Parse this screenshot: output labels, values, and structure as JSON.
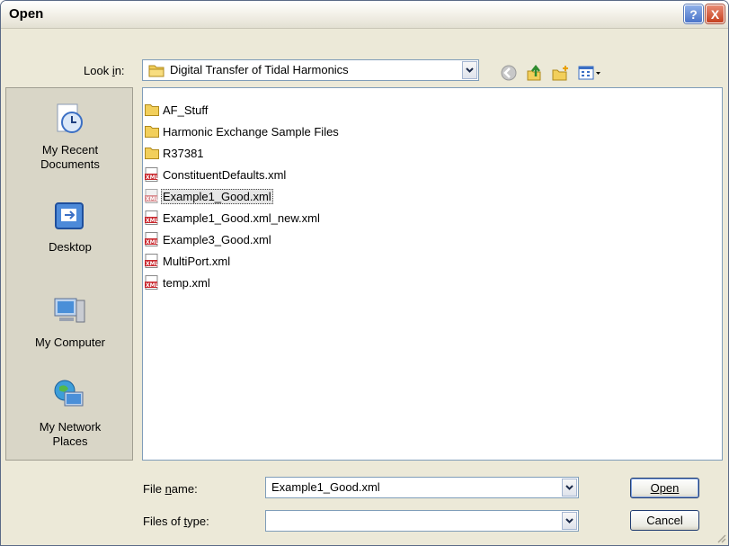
{
  "window": {
    "title": "Open"
  },
  "titlebar_buttons": {
    "help": "?",
    "close": "X"
  },
  "look_in": {
    "label": "Look in:",
    "value": "Digital Transfer of Tidal Harmonics"
  },
  "places": [
    {
      "label_line1": "My Recent",
      "label_line2": "Documents",
      "icon": "recent-documents-icon"
    },
    {
      "label_line1": "Desktop",
      "label_line2": "",
      "icon": "desktop-icon"
    },
    {
      "label_line1": "My Computer",
      "label_line2": "",
      "icon": "my-computer-icon"
    },
    {
      "label_line1": "My Network",
      "label_line2": "Places",
      "icon": "network-places-icon"
    }
  ],
  "files": [
    {
      "name": "AF_Stuff",
      "type": "folder"
    },
    {
      "name": "Harmonic Exchange Sample Files",
      "type": "folder"
    },
    {
      "name": "R37381",
      "type": "folder"
    },
    {
      "name": "ConstituentDefaults.xml",
      "type": "xml"
    },
    {
      "name": "Example1_Good.xml",
      "type": "xml",
      "selected": true
    },
    {
      "name": "Example1_Good.xml_new.xml",
      "type": "xml"
    },
    {
      "name": "Example3_Good.xml",
      "type": "xml"
    },
    {
      "name": "MultiPort.xml",
      "type": "xml"
    },
    {
      "name": "temp.xml",
      "type": "xml"
    }
  ],
  "file_name": {
    "label": "File name:",
    "value": "Example1_Good.xml"
  },
  "files_of_type": {
    "label": "Files of type:",
    "value": ""
  },
  "buttons": {
    "open": "Open",
    "cancel": "Cancel"
  },
  "colors": {
    "selection": "#e6e6e6",
    "border": "#7f9db9",
    "dialog_bg": "#ece9d8"
  }
}
